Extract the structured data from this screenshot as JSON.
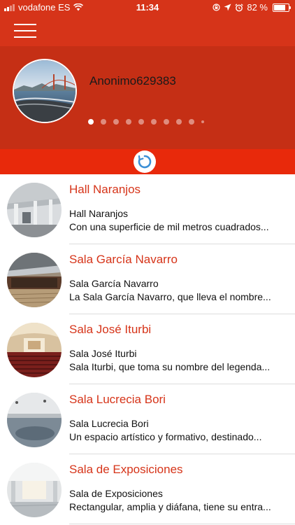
{
  "status_bar": {
    "carrier": "vodafone ES",
    "time": "11:34",
    "battery_percent": "82 %",
    "battery_level": 0.82
  },
  "nav": {
    "menu_icon": "hamburger-menu-icon"
  },
  "profile": {
    "username": "Anonimo629383",
    "carousel": {
      "total_dots": 10,
      "active_index": 0
    }
  },
  "refresh": {
    "icon": "refresh-icon"
  },
  "venues": [
    {
      "title": "Hall Naranjos",
      "name": "Hall Naranjos",
      "description": "Con una superficie de mil metros cuadrados..."
    },
    {
      "title": "Sala García Navarro",
      "name": "Sala García Navarro",
      "description": "La Sala García Navarro, que lleva el nombre..."
    },
    {
      "title": "Sala José Iturbi",
      "name": "Sala José Iturbi",
      "description": "Sala Iturbi, que toma su nombre del legenda..."
    },
    {
      "title": "Sala Lucrecia Bori",
      "name": "Sala Lucrecia Bori",
      "description": "Un espacio artístico y formativo, destinado..."
    },
    {
      "title": "Sala de Exposiciones",
      "name": "Sala de Exposiciones",
      "description": "Rectangular, amplia y diáfana, tiene su entra..."
    }
  ],
  "colors": {
    "nav_bar": "#d63419",
    "header": "#c52f15",
    "strip": "#e8290b",
    "accent_text": "#d63419",
    "refresh_icon": "#3b8fd6"
  }
}
